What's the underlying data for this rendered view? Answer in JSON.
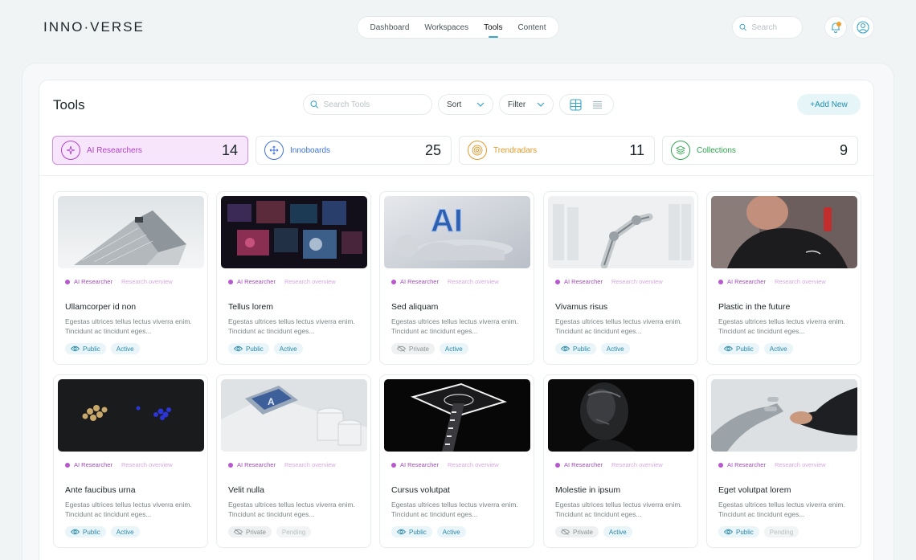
{
  "brand": {
    "logo_text": "INNO·VERSE"
  },
  "nav": {
    "items": [
      {
        "label": "Dashboard",
        "active": false
      },
      {
        "label": "Workspaces",
        "active": false
      },
      {
        "label": "Tools",
        "active": true
      },
      {
        "label": "Content",
        "active": false
      }
    ]
  },
  "header_search": {
    "placeholder": "Search"
  },
  "colors": {
    "accent": "#3aa6c4",
    "notification_dot": "#f0a02a",
    "ai_researcher": "#b858cf"
  },
  "page": {
    "title": "Tools"
  },
  "toolbar": {
    "search_placeholder": "Search Tools",
    "sort_label": "Sort",
    "filter_label": "Filter",
    "add_new_label": "+Add New",
    "views": [
      "grid-view-icon",
      "list-view-icon"
    ]
  },
  "stats": [
    {
      "label": "AI Researchers",
      "count": "14",
      "icon": "sparkle-icon",
      "color": "#b042cc",
      "active": true
    },
    {
      "label": "Innoboards",
      "count": "25",
      "icon": "move-arrows-icon",
      "color": "#3e72d6",
      "active": false
    },
    {
      "label": "Trendradars",
      "count": "11",
      "icon": "radar-icon",
      "color": "#e19a2c",
      "active": false
    },
    {
      "label": "Collections",
      "count": "9",
      "icon": "layers-icon",
      "color": "#2fa44e",
      "active": false
    }
  ],
  "cards": [
    {
      "title": "Ullamcorper id non",
      "type": "AI Researcher",
      "subtype": "Research overview",
      "desc": "Egestas ultrices tellus lectus viverra enim. Tincidunt ac tincidunt eges...",
      "visibility": "Public",
      "status": "Active",
      "image": "building"
    },
    {
      "title": "Tellus lorem",
      "type": "AI Researcher",
      "subtype": "Research overview",
      "desc": "Egestas ultrices tellus lectus viverra enim. Tincidunt ac tincidunt eges...",
      "visibility": "Public",
      "status": "Active",
      "image": "screens"
    },
    {
      "title": "Sed aliquam",
      "type": "AI Researcher",
      "subtype": "Research overview",
      "desc": "Egestas ultrices tellus lectus viverra enim. Tincidunt ac tincidunt eges...",
      "visibility": "Private",
      "status": "Active",
      "image": "ai-hand"
    },
    {
      "title": "Vivamus risus",
      "type": "AI Researcher",
      "subtype": "Research overview",
      "desc": "Egestas ultrices tellus lectus viverra enim. Tincidunt ac tincidunt eges...",
      "visibility": "Public",
      "status": "Active",
      "image": "robot-arm"
    },
    {
      "title": "Plastic in the future",
      "type": "AI Researcher",
      "subtype": "Research overview",
      "desc": "Egestas ultrices tellus lectus viverra enim. Tincidunt ac tincidunt eges...",
      "visibility": "Public",
      "status": "Active",
      "image": "person"
    },
    {
      "title": "Ante faucibus urna",
      "type": "AI Researcher",
      "subtype": "Research overview",
      "desc": "Egestas ultrices tellus lectus viverra enim. Tincidunt ac tincidunt eges...",
      "visibility": "Public",
      "status": "Active",
      "image": "spheres"
    },
    {
      "title": "Velit nulla",
      "type": "AI Researcher",
      "subtype": "Research overview",
      "desc": "Egestas ultrices tellus lectus viverra enim. Tincidunt ac tincidunt eges...",
      "visibility": "Private",
      "status": "Pending",
      "image": "chip"
    },
    {
      "title": "Cursus volutpat",
      "type": "AI Researcher",
      "subtype": "Research overview",
      "desc": "Egestas ultrices tellus lectus viverra enim. Tincidunt ac tincidunt eges...",
      "visibility": "Public",
      "status": "Active",
      "image": "platform"
    },
    {
      "title": "Molestie in ipsum",
      "type": "AI Researcher",
      "subtype": "Research overview",
      "desc": "Egestas ultrices tellus lectus viverra enim. Tincidunt ac tincidunt eges...",
      "visibility": "Private",
      "status": "Active",
      "image": "dark-robot"
    },
    {
      "title": "Eget volutpat lorem",
      "type": "AI Researcher",
      "subtype": "Research overview",
      "desc": "Egestas ultrices tellus lectus viverra enim. Tincidunt ac tincidunt eges...",
      "visibility": "Public",
      "status": "Pending",
      "image": "robot-hand"
    }
  ]
}
